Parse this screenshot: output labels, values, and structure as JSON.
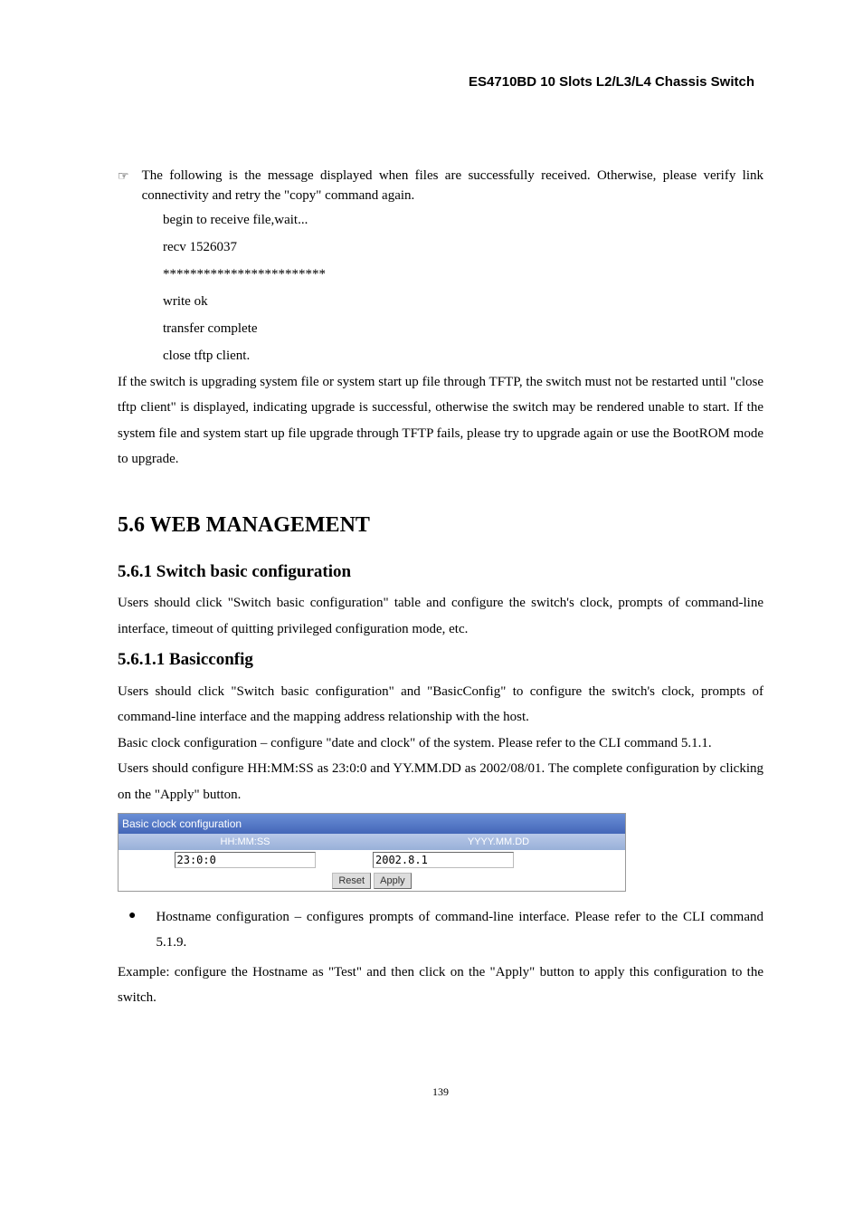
{
  "header": {
    "title": "ES4710BD 10 Slots L2/L3/L4 Chassis Switch"
  },
  "pointer": {
    "line1": "The following is the message displayed when files are successfully received. Otherwise, please",
    "line2": "verify link connectivity and retry the \"copy\" command again."
  },
  "console": {
    "l1": "begin to receive file,wait...",
    "l2": "recv 1526037",
    "l3": "************************",
    "l4": "write ok",
    "l5": "transfer complete",
    "l6": "close tftp client."
  },
  "para1": "If the switch is upgrading system file or system start up file through TFTP, the switch must not be restarted until \"close tftp client\" is displayed, indicating upgrade is successful, otherwise the switch may be rendered unable to start. If the system file and system start up file upgrade through TFTP fails, please try to upgrade again or use the BootROM mode to upgrade.",
  "sec": {
    "h1": "5.6    WEB MANAGEMENT",
    "h2": "5.6.1    Switch basic configuration",
    "p2": "Users should click \"Switch basic configuration\" table and configure the switch's clock, prompts of command-line interface, timeout of quitting privileged configuration mode, etc.",
    "h3": "5.6.1.1    Basicconfig",
    "p3": "Users should click \"Switch basic configuration\" and \"BasicConfig\" to configure the switch's clock, prompts of command-line interface and the mapping address relationship with the host.",
    "p4": "Basic clock configuration – configure \"date and clock\" of the system. Please refer to the CLI command 5.1.1.",
    "p5": "Users should configure HH:MM:SS as 23:0:0 and YY.MM.DD as 2002/08/01. The complete configuration by clicking on the \"Apply\" button."
  },
  "figure": {
    "title": "Basic clock configuration",
    "col1_header": "HH:MM:SS",
    "col2_header": "YYYY.MM.DD",
    "input1": "23:0:0",
    "input2": "2002.8.1",
    "btn_reset": "Reset",
    "btn_apply": "Apply"
  },
  "bullet": {
    "text": "Hostname configuration – configures prompts of command-line interface. Please refer to the CLI command 5.1.9."
  },
  "para_last": "Example: configure the Hostname as \"Test\" and then click on the \"Apply\" button to apply this configuration to the switch.",
  "page_number": "139"
}
